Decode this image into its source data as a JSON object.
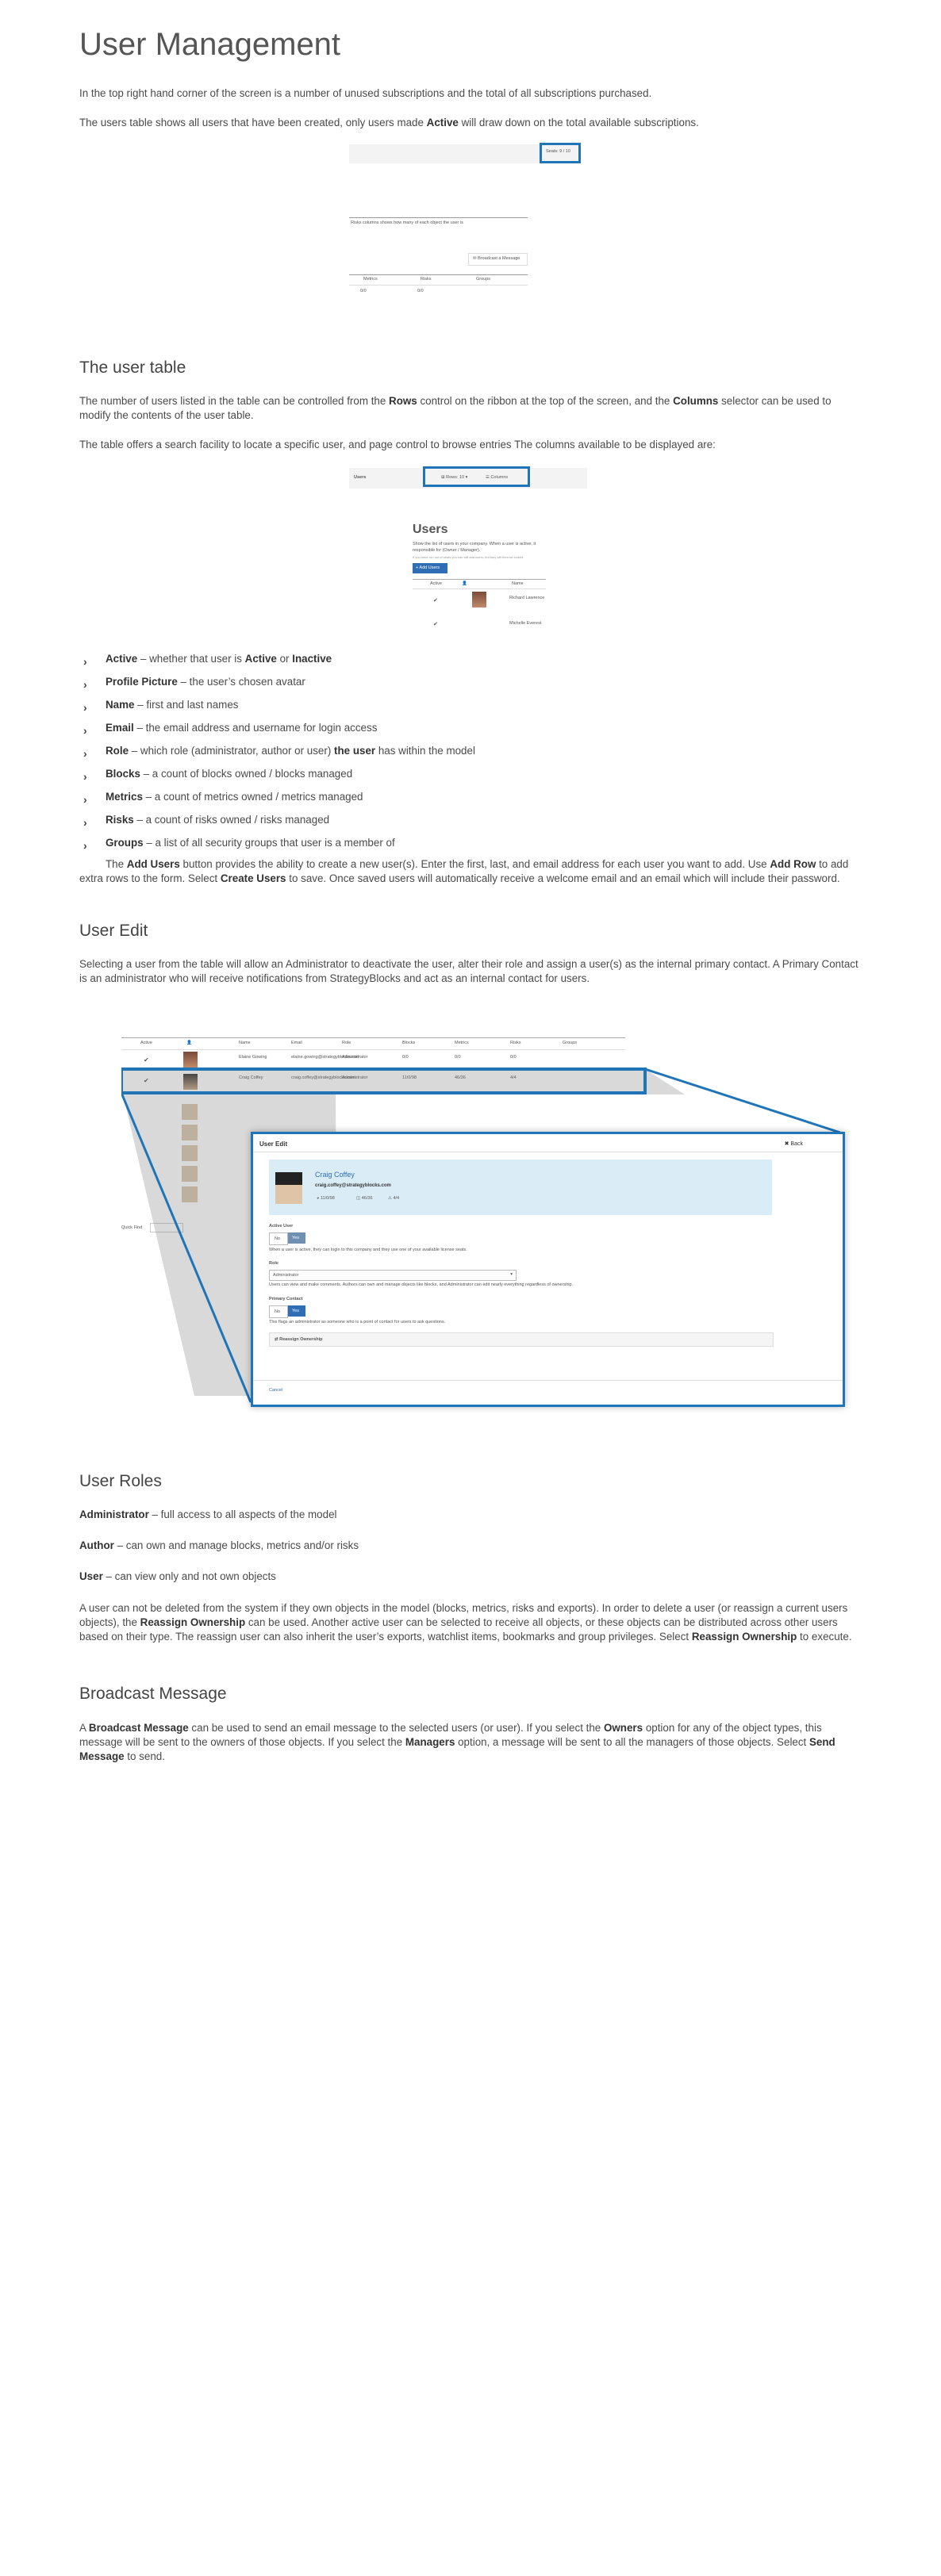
{
  "title": "User Management",
  "intro": {
    "p1": "In the top right hand corner of the screen is a number of unused subscriptions and the total of all subscriptions purchased.",
    "p2_a": "The users table shows all users that have been created, only users made ",
    "p2_b": "Active",
    "p2_c": " will draw down on the total available subscriptions."
  },
  "shot1": {
    "badge": "Seats: 9 / 10",
    "caption": "Risks columns shows how many of each object the user is",
    "broadcast": "✉ Broadcast a Message",
    "cols": [
      "Metrics",
      "Risks",
      "Groups"
    ],
    "vals": [
      "0/0",
      "0/0"
    ]
  },
  "user_table": {
    "heading": "The user table",
    "p1_a": "The number of users listed in the table can be controlled from the ",
    "p1_b": "Rows",
    "p1_c": " control on the ribbon at the top of the screen, and the ",
    "p1_d": "Columns",
    "p1_e": " selector can be used to modify the contents of the user table.",
    "p2": "The table offers a search facility to locate a specific user, and page control to browse entries The columns available to be displayed are:"
  },
  "shot2": {
    "rows_label": "Users",
    "rows_btn": "⊞ Rows: 10 ▾",
    "cols_btn": "☰ Columns"
  },
  "shot3": {
    "title": "Users",
    "desc": "Show the list of users in your company. When a user is active, it",
    "desc2": "responsible for (Owner / Manager).",
    "note": "If you have run out of seats you can still add users, but they will then be locked.",
    "add": "+ Add Users",
    "h_active": "Active",
    "h_name": "Name",
    "name1": "Richard Lawrence",
    "name2": "Michelle Everest"
  },
  "features": [
    {
      "b": "Active",
      "t": " – whether that user is ",
      "b2": "Active",
      "t2": " or ",
      "b3": "Inactive"
    },
    {
      "b": "Profile Picture",
      "t": " – the user’s chosen avatar"
    },
    {
      "b": "Name",
      "t": " – first and last names"
    },
    {
      "b": "Email",
      "t": " – the email address and username for login access"
    },
    {
      "b": "Role",
      "t": " – which role (administrator, author or user) ",
      "b2": "the user",
      "t2": " has within the model"
    },
    {
      "b": "Blocks",
      "t": " – a count of blocks owned / blocks managed"
    },
    {
      "b": "Metrics",
      "t": " – a count of metrics  owned / metrics managed"
    },
    {
      "b": "Risks",
      "t": " – a count of risks owned / risks managed"
    },
    {
      "b": "Groups",
      "t": " – a list of all security groups that user is a member of"
    }
  ],
  "add_users": {
    "a": "The ",
    "b": "Add Users",
    "c": " button provides the ability to create a new user(s).  Enter the first, last, and email address for each user you want to add.  Use ",
    "d": "Add Row",
    "e": " to add extra rows to the form. Select ",
    "f": "Create Users",
    "g": " to save.  Once saved users will automatically receive a welcome email and an email which will include their password."
  },
  "user_edit": {
    "heading": "User Edit",
    "p": "Selecting a user from the table will allow an Administrator to deactivate the user, alter their role and assign a user(s) as the internal primary contact. A Primary Contact is an administrator who will receive notifications from StrategyBlocks and act as an internal contact for users."
  },
  "shot4": {
    "table_head": [
      "Active",
      "",
      "Name",
      "Email",
      "Role",
      "Blocks",
      "Metrics",
      "Risks",
      "Groups"
    ],
    "row1": [
      "✔",
      "",
      "Elaine Gowing",
      "elaine.gowing@strategyblocks.com",
      "Administrator",
      "0/0",
      "0/0",
      "0/0",
      ""
    ],
    "row2": [
      "✔",
      "",
      "Craig Coffey",
      "craig.coffey@strategyblocks.com",
      "Administrator",
      "11/0/98",
      "46/36",
      "4/4",
      ""
    ],
    "quick_find": "Quick Find",
    "modal_title": "User Edit",
    "back": "✖ Back",
    "user_name": "Craig Coffey",
    "user_email": "craig.coffey@strategyblocks.com",
    "stat1": "11/0/98",
    "stat2": "46/36",
    "stat3": "4/4",
    "active_label": "Active User",
    "no": "No",
    "yes": "Yes",
    "active_help": "When a user is active, they can login to this company and they use one of your available license seats.",
    "role_label": "Role",
    "role_value": "Administrator",
    "role_help": "Users can view and make comments. Authors can own and manage objects like blocks, and Administrator can edit nearly everything regardless of ownership.",
    "primary_label": "Primary Contact",
    "primary_help": "This flags an administrator as someone who is a point of contact for users to ask questions.",
    "reassign": "⇄ Reassign Ownership",
    "cancel": "Cancel"
  },
  "user_roles": {
    "heading": "User Roles",
    "admin_b": "Administrator",
    "admin_t": " – full access to all aspects of the model",
    "author_b": "Author",
    "author_t": " – can own and manage blocks, metrics and/or risks",
    "user_b": "User",
    "user_t": " – can view only and not own objects",
    "p_a": "A user can not be deleted from the system if they own objects in the model (blocks, metrics, risks and exports).  In order to delete a user (or reassign a current users objects), the ",
    "p_b": "Reassign Ownership",
    "p_c": " can be used. Another active user can be selected to receive all objects, or these objects can be distributed across other users based on their type.  The reassign user can also inherit the user’s exports, watchlist items, bookmarks and group privileges. Select ",
    "p_d": "Reassign Ownership",
    "p_e": " to execute."
  },
  "broadcast": {
    "heading": "Broadcast Message",
    "a": "A ",
    "b": "Broadcast Message",
    "c": " can be used to send an email message to the selected users (or user). If you select the ",
    "d": "Owners",
    "e": " option for any of the object types, this message will be sent to the owners of those objects. If you select the ",
    "f": "Managers",
    "g": " option, a message will be sent to all the managers of those objects. Select ",
    "h": "Send Message",
    "i": " to send."
  },
  "colors": {
    "accent": "#1f75b8",
    "text": "#444444"
  }
}
